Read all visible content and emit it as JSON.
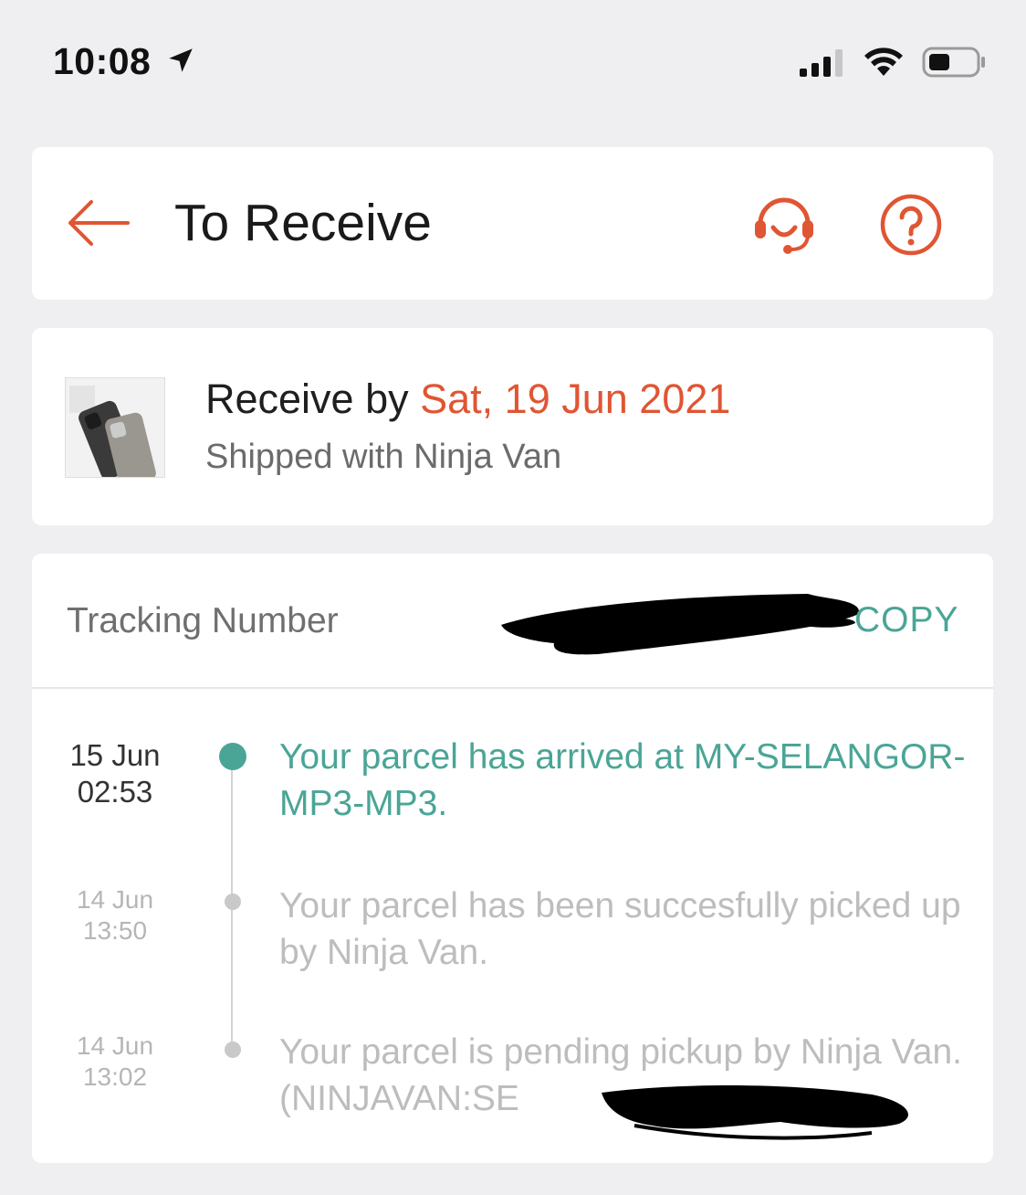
{
  "status_bar": {
    "time": "10:08",
    "icons": [
      "location-arrow-icon",
      "signal-icon",
      "wifi-icon",
      "battery-icon"
    ]
  },
  "header": {
    "title": "To Receive",
    "icons": [
      "back-arrow-icon",
      "headset-icon",
      "help-icon"
    ],
    "accent_color": "#e05533"
  },
  "delivery": {
    "receive_prefix": "Receive by",
    "receive_date": "Sat, 19 Jun 2021",
    "shipped_with": "Shipped with Ninja Van"
  },
  "tracking": {
    "label": "Tracking Number",
    "copy_label": "COPY",
    "events": [
      {
        "date": "15 Jun",
        "time": "02:53",
        "text": "Your parcel has arrived at MY-SELANGOR-MP3-MP3.",
        "active": true
      },
      {
        "date": "14 Jun",
        "time": "13:50",
        "text": "Your parcel has been succesfully picked up by Ninja Van.",
        "active": false
      },
      {
        "date": "14 Jun",
        "time": "13:02",
        "text": "Your parcel is pending pickup by Ninja Van. (NINJAVAN:SE",
        "active": false
      }
    ],
    "active_color": "#4aa596",
    "inactive_color": "#bdbdbd"
  }
}
